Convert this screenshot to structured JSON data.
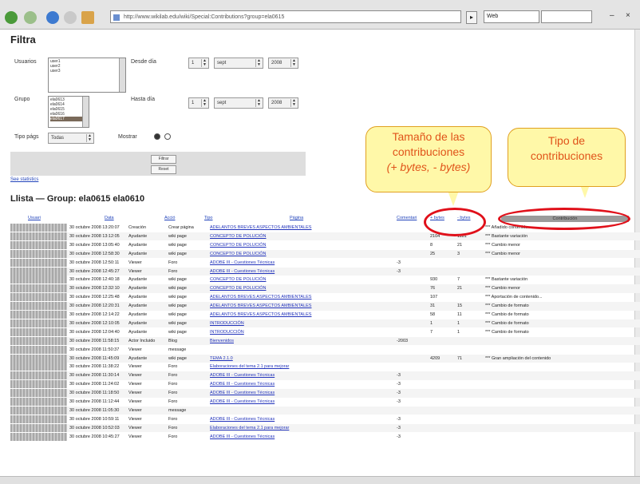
{
  "browser": {
    "url": "http://www.wikilab.edu/wiki/Special:Contributions?group=ela0615",
    "google_placeholder": "Web",
    "go_label": "▸",
    "minimize": "–",
    "close": "×"
  },
  "filter": {
    "title": "Filtra",
    "user_label": "Usuarios",
    "desde_label": "Desde día",
    "group_label": "Grupo",
    "hasta_label": "Hasta día",
    "tipo_label": "Tipo págs",
    "tipo_value": "Todas",
    "mostrar_label": "Mostrar",
    "desde_day": "1",
    "desde_month": "sept",
    "desde_year": "2008",
    "hasta_day": "1",
    "hasta_month": "sept",
    "hasta_year": "2008",
    "user_options": [
      "user1",
      "user2",
      "user3"
    ],
    "group_options": [
      "ela0613",
      "ela0614",
      "ela0615",
      "ela0616",
      "ela0617"
    ],
    "group_selected_index": 4,
    "btn1": "Filtrar",
    "btn2": "Reset",
    "stats_link": "See statistics"
  },
  "list": {
    "title": "Llista  — Group: ela0615 ela0610"
  },
  "table": {
    "headers": [
      "Usuari",
      "Data",
      "Acció",
      "Tipo",
      "Página",
      "Comentari",
      "+ bytes",
      "- bytes",
      "Contribución"
    ],
    "rows": [
      [
        "30 octubre 2008 13:20:07",
        "Creación",
        "Crear página",
        "ADELANTOS BREVES ASPECTOS AMBIENTALES",
        "",
        "",
        "",
        "*** Añadido contenido..."
      ],
      [
        "30 octubre 2008 13:12:05",
        "Ayudante",
        "wiki page",
        "CONCEPTO DE POLUCIÓN",
        "",
        "2104",
        "1181",
        "*** Bastante variación"
      ],
      [
        "30 octubre 2008 13:05:40",
        "Ayudante",
        "wiki page",
        "CONCEPTO DE POLUCIÓN",
        "",
        "8",
        "21",
        "*** Cambio menor"
      ],
      [
        "30 octubre 2008 12:58:30",
        "Ayudante",
        "wiki page",
        "CONCEPTO DE POLUCIÓN",
        "",
        "25",
        "3",
        "*** Cambio menor"
      ],
      [
        "30 octubre 2008 12:50:11",
        "Viewer",
        "Foro",
        "ADOBE III - Cuestiones Técnicas",
        "-3",
        "",
        "",
        ""
      ],
      [
        "30 octubre 2008 12:45:27",
        "Viewer",
        "Foro",
        "ADOBE III - Cuestiones Técnicas",
        "-3",
        "",
        "",
        ""
      ],
      [
        "30 octubre 2008 12:40:18",
        "Ayudante",
        "wiki page",
        "CONCEPTO DE POLUCIÓN",
        "",
        "930",
        "7",
        "*** Bastante variación"
      ],
      [
        "30 octubre 2008 12:32:10",
        "Ayudante",
        "wiki page",
        "CONCEPTO DE POLUCIÓN",
        "",
        "76",
        "21",
        "*** Cambio menor"
      ],
      [
        "30 octubre 2008 12:25:48",
        "Ayudante",
        "wiki page",
        "ADELANTOS BREVES ASPECTOS AMBIENTALES",
        "",
        "107",
        "",
        "*** Aportación de contenido..."
      ],
      [
        "30 octubre 2008 12:20:31",
        "Ayudante",
        "wiki page",
        "ADELANTOS BREVES ASPECTOS AMBIENTALES",
        "",
        "31",
        "15",
        "*** Cambio de formato"
      ],
      [
        "30 octubre 2008 12:14:22",
        "Ayudante",
        "wiki page",
        "ADELANTOS BREVES ASPECTOS AMBIENTALES",
        "",
        "58",
        "11",
        "*** Cambio de formato"
      ],
      [
        "30 octubre 2008 12:10:05",
        "Ayudante",
        "wiki page",
        "INTRODUCCIÓN",
        "",
        "1",
        "1",
        "*** Cambio de formato"
      ],
      [
        "30 octubre 2008 12:04:40",
        "Ayudante",
        "wiki page",
        "INTRODUCCIÓN",
        "",
        "7",
        "1",
        "*** Cambio de formato"
      ],
      [
        "30 octubre 2008 11:58:15",
        "Actor Incluido",
        "Blog",
        "Bienvenidos",
        "-2003",
        "",
        "",
        ""
      ],
      [
        "30 octubre 2008 11:50:37",
        "Viewer",
        "message",
        "",
        "",
        "",
        "",
        ""
      ],
      [
        "30 octubre 2008 11:45:09",
        "Ayudante",
        "wiki page",
        "TEMA 2.1.0",
        "",
        "4209",
        "71",
        "*** Gran ampliación del contenido"
      ],
      [
        "30 octubre 2008 11:38:22",
        "Viewer",
        "Foro",
        "Elaboraciones del tema 2.1 para mejorar",
        "",
        "",
        "",
        ""
      ],
      [
        "30 octubre 2008 11:30:14",
        "Viewer",
        "Foro",
        "ADOBE III - Cuestiones Técnicas",
        "-3",
        "",
        "",
        ""
      ],
      [
        "30 octubre 2008 11:24:02",
        "Viewer",
        "Foro",
        "ADOBE III - Cuestiones Técnicas",
        "-3",
        "",
        "",
        ""
      ],
      [
        "30 octubre 2008 11:18:50",
        "Viewer",
        "Foro",
        "ADOBE III - Cuestiones Técnicas",
        "-3",
        "",
        "",
        ""
      ],
      [
        "30 octubre 2008 11:12:44",
        "Viewer",
        "Foro",
        "ADOBE III - Cuestiones Técnicas",
        "-3",
        "",
        "",
        ""
      ],
      [
        "30 octubre 2008 11:05:30",
        "Viewer",
        "message",
        "",
        "",
        "",
        "",
        ""
      ],
      [
        "30 octubre 2008 10:59:11",
        "Viewer",
        "Foro",
        "ADOBE III - Cuestiones Técnicas",
        "-3",
        "",
        "",
        ""
      ],
      [
        "30 octubre 2008 10:52:03",
        "Viewer",
        "Foro",
        "Elaboraciones del tema 2.1 para mejorar",
        "-3",
        "",
        "",
        ""
      ],
      [
        "30 octubre 2008 10:45:27",
        "Viewer",
        "Foro",
        "ADOBE III - Cuestiones Técnicas",
        "-3",
        "",
        "",
        ""
      ]
    ]
  },
  "annotations": {
    "callout1": [
      "Tamaño de las",
      "contribuciones",
      "(+ bytes, - bytes)"
    ],
    "callout2": [
      "Tipo de",
      "contribuciones"
    ],
    "callout_color": "#e0531a",
    "ellipse_color": "#e0101a"
  }
}
